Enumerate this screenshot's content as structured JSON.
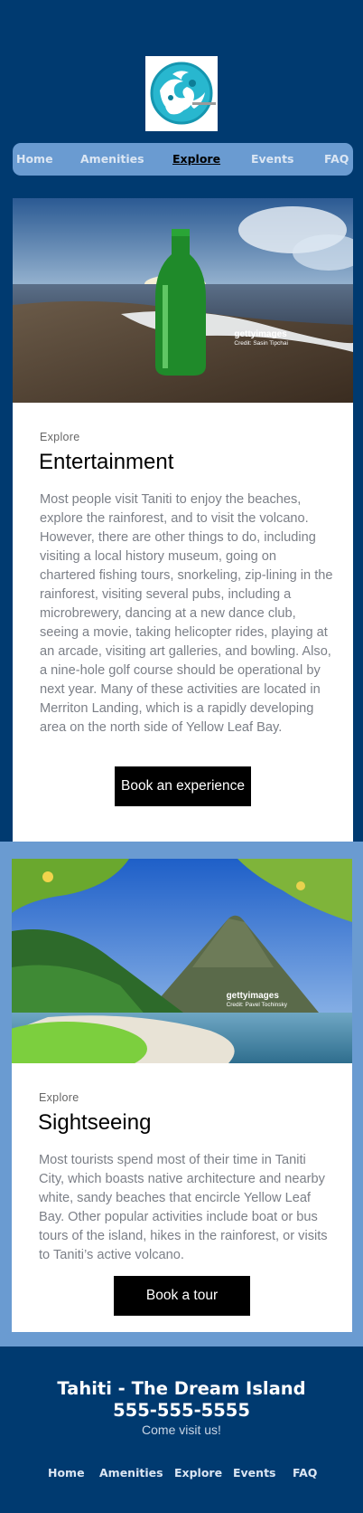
{
  "header": {
    "logo_icon": "swirl-wave-logo-icon",
    "nav": [
      {
        "label": "Home",
        "active": false
      },
      {
        "label": "Amenities",
        "active": false
      },
      {
        "label": "Explore",
        "active": true
      },
      {
        "label": "Events",
        "active": false
      },
      {
        "label": "FAQ",
        "active": false
      }
    ]
  },
  "sections": [
    {
      "photo_icon": "beach-bottle-photo",
      "photo_brand": "gettyimages",
      "photo_credit": "Credit: Sasin Tipchai",
      "kicker": "Explore",
      "title": "Entertainment",
      "body": "Most people visit Taniti to enjoy the beaches, explore the rainforest, and to visit the volcano. However, there are other things to do, including visiting a local history museum, going on chartered fishing tours, snorkeling, zip-lining in the rainforest, visiting several pubs, including a microbrewery, dancing at a new dance club, seeing a movie, taking helicopter rides, playing at an arcade, visiting art galleries, and bowling. Also, a nine-hole golf course should be operational by next year. Many of these activities are located in Merriton Landing, which is a rapidly developing area on the north side of Yellow Leaf Bay.",
      "button": "Book an experience"
    },
    {
      "photo_icon": "mountain-beach-photo",
      "photo_brand": "gettyimages",
      "photo_credit": "Credit: Pavel Tochinsky",
      "kicker": "Explore",
      "title": "Sightseeing",
      "body": "Most tourists spend most of their time in Taniti City, which boasts native architecture and nearby white, sandy beaches that encircle Yellow Leaf Bay. Other popular activities include boat or bus tours of the island, hikes in the rainforest, or visits to Taniti’s active volcano.",
      "button": "Book a tour"
    }
  ],
  "footer": {
    "title": "Tahiti - The Dream Island",
    "phone": "555-555-5555",
    "tagline": "Come visit us!",
    "nav": [
      "Home",
      "Amenities",
      "Explore",
      "Events",
      "FAQ"
    ]
  },
  "colors": {
    "background": "#003a70",
    "nav_band": "#6a9bd1",
    "button": "#000000"
  }
}
